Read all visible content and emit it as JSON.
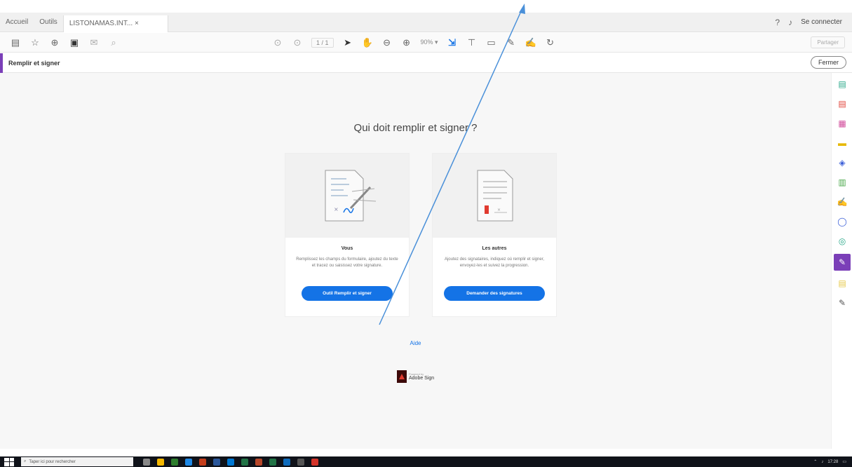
{
  "tabs": {
    "home": "Accueil",
    "tools": "Outils",
    "document": "LISTONAMAS.INT... ×"
  },
  "topbar": {
    "help_icon": "help-icon",
    "bell_icon": "bell-icon",
    "sign_in": "Se connecter"
  },
  "toolbar": {
    "pager": "1 / 1",
    "zoom": "90% ▾",
    "share": "Partager"
  },
  "tool_header": {
    "title": "Remplir et signer",
    "close": "Fermer"
  },
  "main": {
    "heading": "Qui doit remplir et signer ?",
    "cards": [
      {
        "title": "Vous",
        "description": "Remplissez les champs du formulaire, ajoutez du texte et tracez ou saisissez votre signature.",
        "button": "Outil Remplir et signer"
      },
      {
        "title": "Les autres",
        "description": "Ajoutez des signataires, indiquez où remplir et signer, envoyez-les et suivez la progression.",
        "button": "Demander des signatures"
      }
    ],
    "help": "Aide",
    "brand_small": "Powered by",
    "brand_name": "Adobe Sign"
  },
  "taskbar": {
    "search_placeholder": "Taper ici pour rechercher",
    "time": "17:28"
  },
  "colors": {
    "accent_purple": "#7b3fb8",
    "primary_blue": "#1473e6",
    "arrow_blue": "#4a90d9"
  }
}
